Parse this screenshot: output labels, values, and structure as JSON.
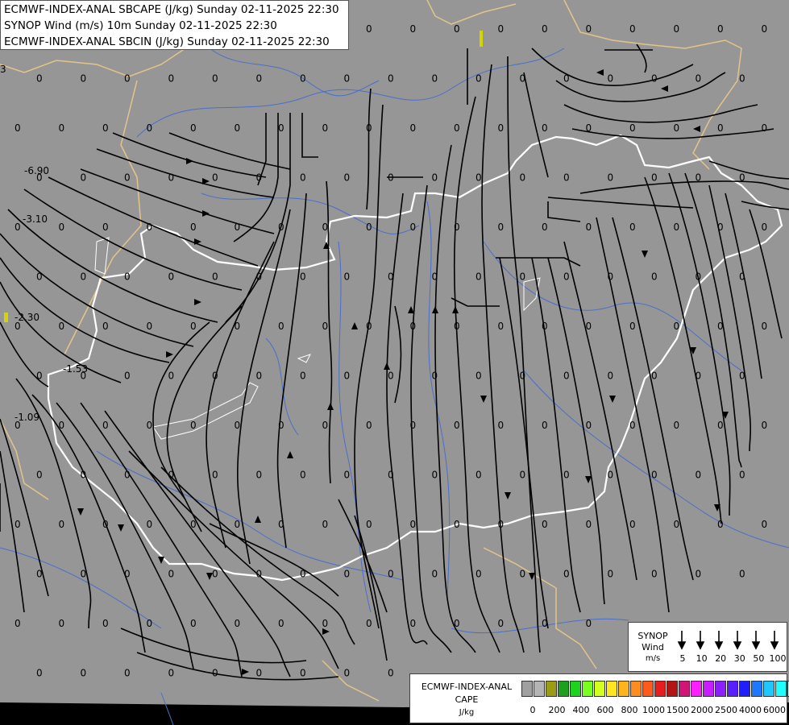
{
  "header": {
    "line1": "ECMWF-INDEX-ANAL SBCAPE (J/kg) Sunday 02-11-2025 22:30",
    "line2": "SYNOP Wind (m/s) 10m Sunday 02-11-2025 22:30",
    "line3": "ECMWF-INDEX-ANAL SBCIN (J/kg) Sunday 02-11-2025 22:30"
  },
  "colors": {
    "background": "#969696",
    "border_country": "#ffffff",
    "border_region": "#e3c48a",
    "rivers": "#4a6fc9",
    "streamlines": "#000000"
  },
  "cin_labels": [
    "-6.90",
    "-3.10",
    "-2.30",
    "-1.53",
    "-1.09",
    "3"
  ],
  "grid_value": "0",
  "wind_legend": {
    "title_line1": "SYNOP",
    "title_line2": "Wind",
    "unit": "m/s",
    "speeds": [
      "5",
      "10",
      "20",
      "30",
      "50",
      "100"
    ]
  },
  "cape_legend": {
    "title_line1": "ECMWF-INDEX-ANAL",
    "title_line2": "CAPE",
    "unit": "J/kg",
    "colors": [
      "#a0a0a0",
      "#b4b4b4",
      "#9c9c14",
      "#1ea01e",
      "#1ed21e",
      "#78ff1e",
      "#d2ff1e",
      "#ffe61e",
      "#ffb41e",
      "#ff8c1e",
      "#ff5a1e",
      "#e61e1e",
      "#b41414",
      "#d21478",
      "#ff1eff",
      "#c81eff",
      "#8c1eff",
      "#5a1eff",
      "#1e1eff",
      "#1e78ff",
      "#1ec8ff",
      "#1effff",
      "#b4ffff",
      "#ffffff"
    ],
    "ticks": [
      "0",
      "200",
      "400",
      "600",
      "800",
      "1000",
      "1500",
      "2000",
      "2500",
      "4000",
      "6000"
    ]
  }
}
